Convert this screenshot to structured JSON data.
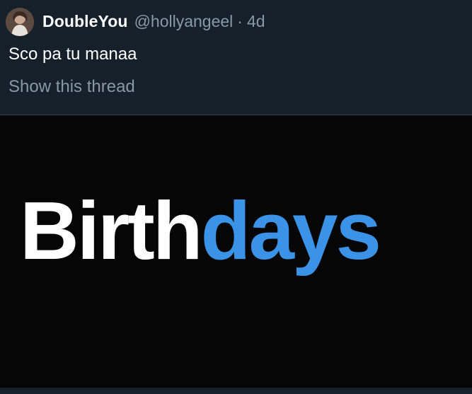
{
  "tweet": {
    "display_name": "DoubleYou",
    "handle": "@hollyangeel",
    "separator": "·",
    "age": "4d",
    "text": "Sco pa tu manaa",
    "show_thread": "Show this thread"
  },
  "media": {
    "title_part_1": "Birth",
    "title_part_2": "days"
  },
  "colors": {
    "background": "#15202b",
    "secondary_text": "#8899a6",
    "accent_blue": "#3b93e8",
    "media_background": "#060606"
  }
}
